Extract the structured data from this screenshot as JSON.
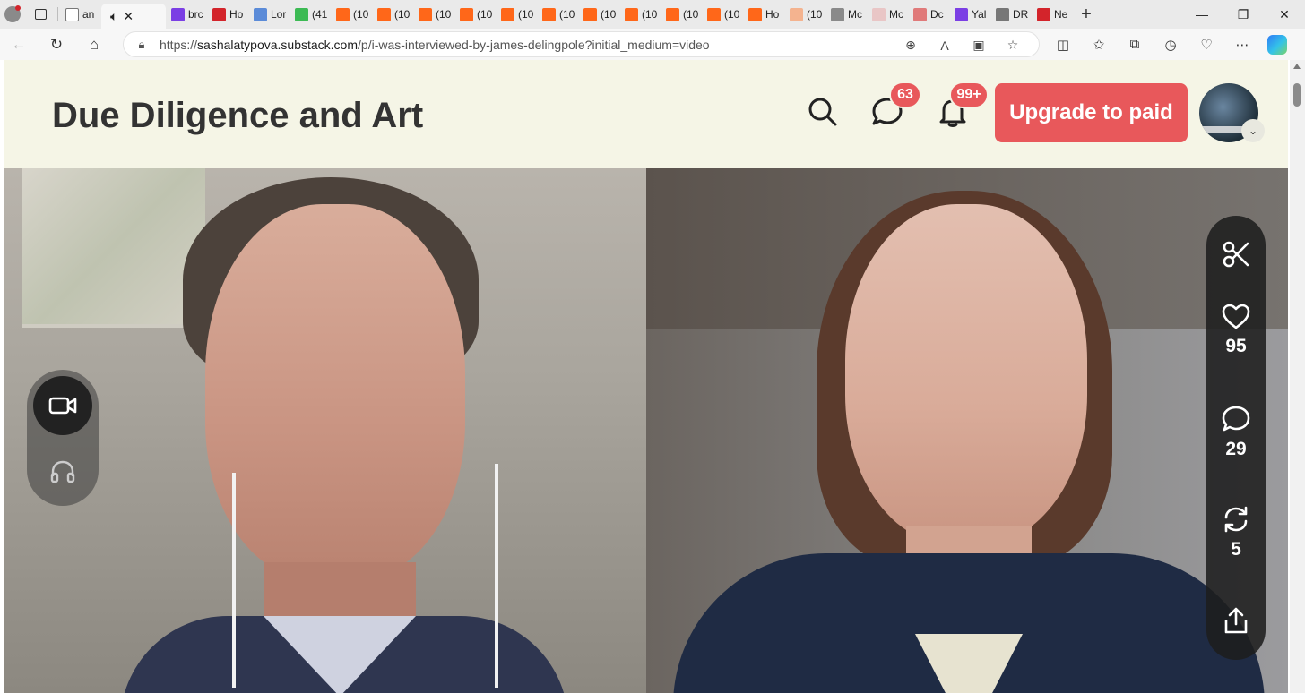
{
  "browser": {
    "tabs": [
      {
        "label": "an",
        "favicon": "page-icon",
        "color": "#ffffff"
      },
      {
        "label": "brc",
        "favicon": "yahoo-icon",
        "color": "#7b3fe4"
      },
      {
        "label": "Ho",
        "favicon": "pin-icon",
        "color": "#d3242b"
      },
      {
        "label": "Lor",
        "favicon": "five-icon",
        "color": "#5b8bd8"
      },
      {
        "label": "(41",
        "favicon": "g-icon",
        "color": "#3cba54"
      },
      {
        "label": "(10",
        "favicon": "substack-icon",
        "color": "#ff6719"
      },
      {
        "label": "(10",
        "favicon": "substack-icon",
        "color": "#ff6719"
      },
      {
        "label": "(10",
        "favicon": "substack-icon",
        "color": "#ff6719"
      },
      {
        "label": "(10",
        "favicon": "substack-icon",
        "color": "#ff6719"
      },
      {
        "label": "(10",
        "favicon": "substack-icon",
        "color": "#ff6719"
      },
      {
        "label": "(10",
        "favicon": "substack-icon",
        "color": "#ff6719"
      },
      {
        "label": "(10",
        "favicon": "substack-icon",
        "color": "#ff6719"
      },
      {
        "label": "(10",
        "favicon": "substack-icon",
        "color": "#ff6719"
      },
      {
        "label": "(10",
        "favicon": "substack-icon",
        "color": "#ff6719"
      },
      {
        "label": "(10",
        "favicon": "substack-icon",
        "color": "#ff6719"
      },
      {
        "label": "Ho",
        "favicon": "substack-icon",
        "color": "#ff6719"
      },
      {
        "label": "(10",
        "favicon": "substack-icon",
        "color": "#f4b38f"
      },
      {
        "label": "Mc",
        "favicon": "wordpress-icon",
        "color": "#8a8a8a"
      },
      {
        "label": "Mc",
        "favicon": "bi-icon",
        "color": "#e9c6c6"
      },
      {
        "label": "Dc",
        "favicon": "youtube-icon",
        "color": "#e07a7a"
      },
      {
        "label": "Yal",
        "favicon": "yahoo-icon",
        "color": "#7b3fe4"
      },
      {
        "label": "DR",
        "favicon": "slash-icon",
        "color": "#777777"
      },
      {
        "label": "Ne",
        "favicon": "r-icon",
        "color": "#d3242b"
      }
    ],
    "active_tab_index": 1,
    "url_prefix": "https://",
    "url_host": "sashalatypova.substack.com",
    "url_path": "/p/i-was-interviewed-by-james-delingpole?initial_medium=video"
  },
  "site": {
    "title": "Due Diligence and Art",
    "chat_badge": "63",
    "notif_badge": "99+",
    "upgrade_label": "Upgrade to paid",
    "accent": "#e8585b",
    "header_bg": "#f5f5e6"
  },
  "rail": {
    "likes": "95",
    "comments": "29",
    "restacks": "5"
  }
}
